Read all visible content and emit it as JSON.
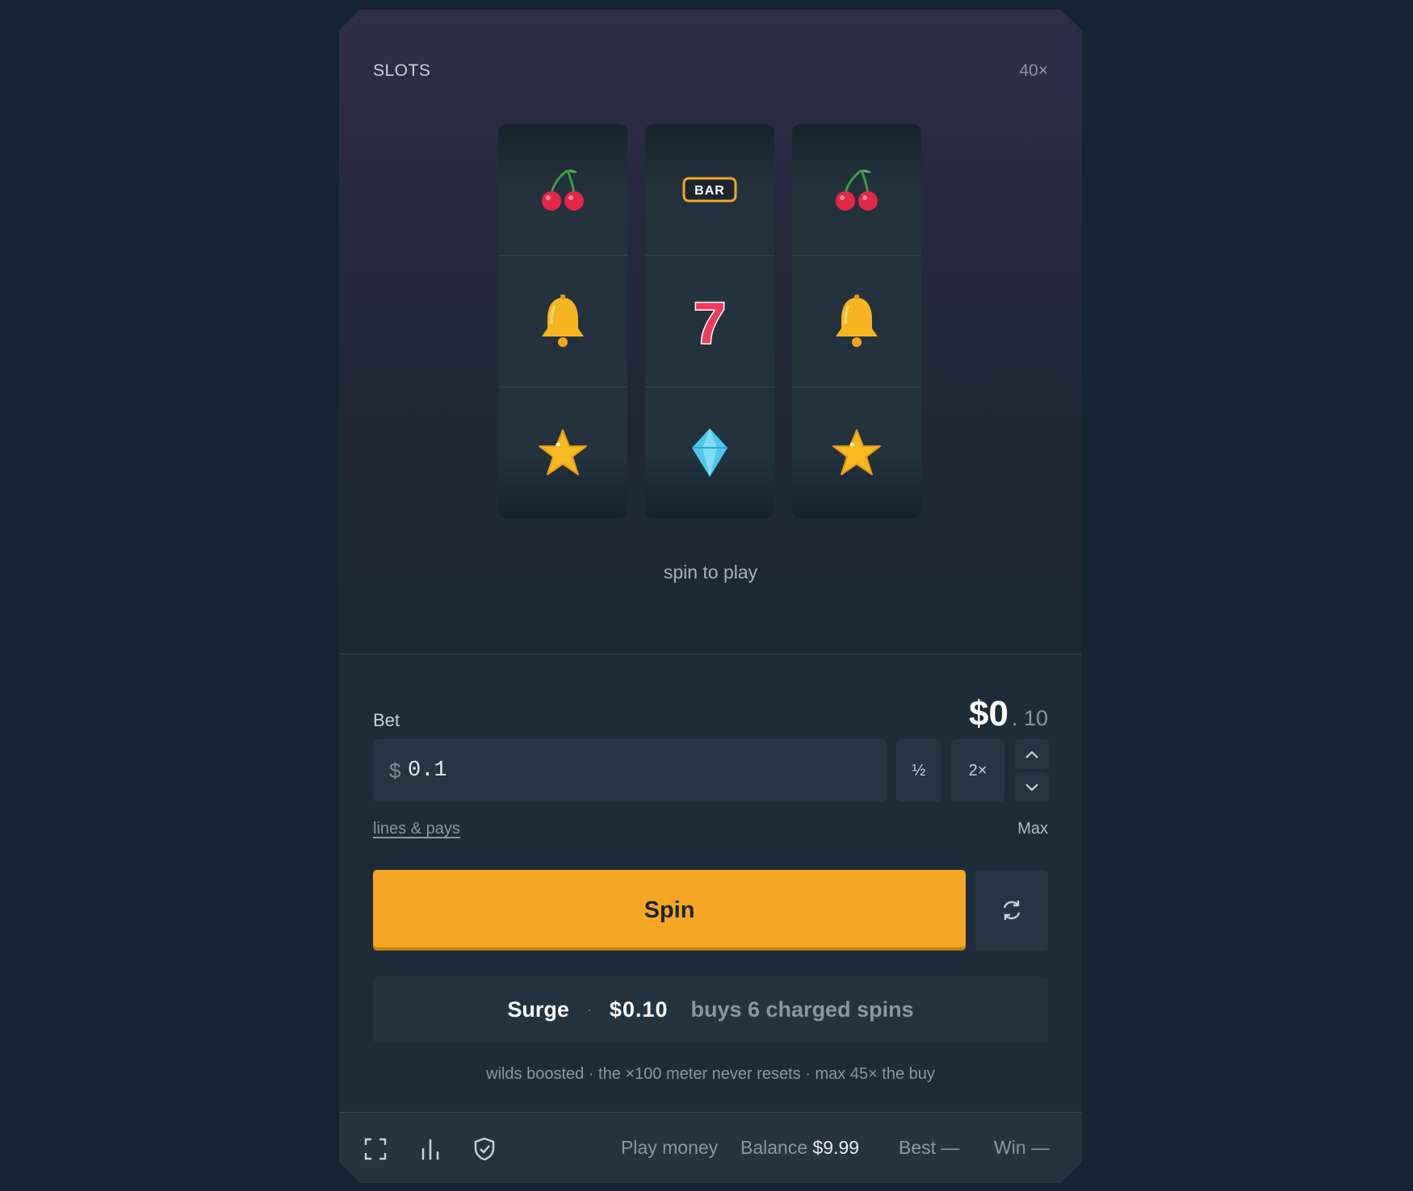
{
  "game": {
    "title": "SLOTS",
    "multiplier": "40×"
  },
  "reels": [
    {
      "symbols": [
        "cherry",
        "bell",
        "star"
      ]
    },
    {
      "symbols": [
        "bar",
        "seven",
        "diamond"
      ]
    },
    {
      "symbols": [
        "cherry",
        "bell",
        "star"
      ]
    }
  ],
  "symbol_text": {
    "bar": "BAR",
    "seven": "7"
  },
  "status": "spin to play",
  "bet": {
    "label": "Bet",
    "display_main": "$0",
    "display_cents": ". 10",
    "currency": "$",
    "input_value": "0.1",
    "half_label": "½",
    "double_label": "2×",
    "lines_link": "lines & pays",
    "max_label": "Max"
  },
  "actions": {
    "spin_label": "Spin",
    "auto_icon": "refresh-icon"
  },
  "surge": {
    "title": "Surge",
    "separator": "·",
    "price": "$0.10",
    "description": "buys 6 charged spins",
    "note": "wilds boosted · the ×100 meter never resets · max 45× the buy"
  },
  "footer": {
    "icons": [
      "fullscreen-icon",
      "stats-icon",
      "shield-icon"
    ],
    "mode": "Play money",
    "balance_label": "Balance",
    "balance_value": "$9.99",
    "best": "Best —",
    "win": "Win —"
  },
  "colors": {
    "accent": "#f5a623",
    "background": "#142432",
    "panel": "#1e2b38"
  }
}
